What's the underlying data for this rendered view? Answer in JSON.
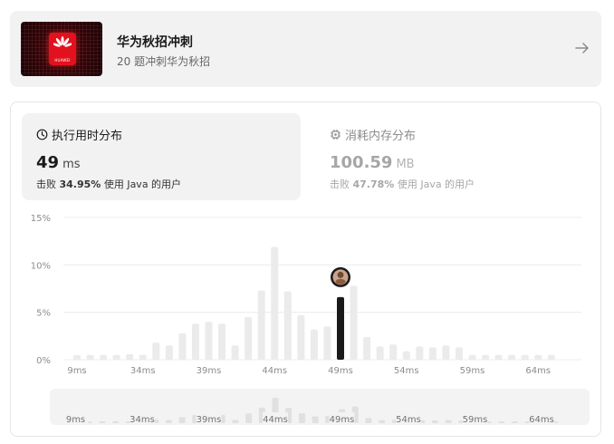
{
  "banner": {
    "title": "华为秋招冲刺",
    "subtitle": "20 题冲刺华为秋招",
    "logo_text": "HUAWEI",
    "arrow_icon": "arrow-right-icon"
  },
  "stats": {
    "runtime": {
      "heading": "执行用时分布",
      "icon": "clock-icon",
      "value": "49",
      "unit": "ms",
      "beat_prefix": "击败",
      "beat_percent": "34.95%",
      "beat_suffix": "使用 Java 的用户"
    },
    "memory": {
      "heading": "消耗内存分布",
      "icon": "chip-icon",
      "value": "100.59",
      "unit": "MB",
      "beat_prefix": "击败",
      "beat_percent": "47.78%",
      "beat_suffix": "使用 Java 的用户"
    }
  },
  "chart_data": {
    "type": "bar",
    "y_ticks": [
      "15%",
      "10%",
      "5%",
      "0%"
    ],
    "ylim": [
      0,
      15
    ],
    "x_ticks": [
      "9ms",
      "34ms",
      "39ms",
      "44ms",
      "49ms",
      "54ms",
      "59ms",
      "64ms"
    ],
    "values": [
      0.5,
      0.5,
      0.5,
      0.5,
      0.6,
      0.5,
      1.8,
      1.5,
      2.8,
      3.8,
      4.0,
      3.8,
      1.5,
      4.5,
      7.3,
      11.9,
      7.2,
      4.7,
      3.2,
      3.5,
      6.6,
      7.8,
      2.4,
      1.4,
      1.6,
      0.9,
      1.4,
      1.3,
      1.5,
      1.3,
      0.5,
      0.5,
      0.5,
      0.5,
      0.5,
      0.5,
      0.5
    ],
    "highlight_index": 20,
    "colors": {
      "bar": "#ebebeb",
      "highlight": "#1a1a1a",
      "grid": "#ececec",
      "axis_text": "#8c8c8c"
    },
    "overview": {
      "x_ticks": [
        "9ms",
        "34ms",
        "39ms",
        "44ms",
        "49ms",
        "54ms",
        "59ms",
        "64ms"
      ]
    }
  }
}
